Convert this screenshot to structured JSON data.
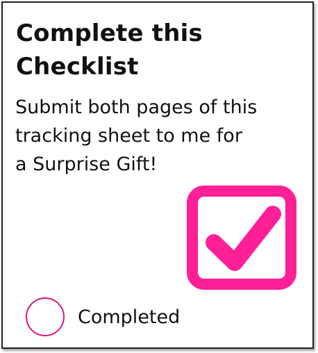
{
  "card": {
    "title_line1": "Complete this",
    "title_line2": "Checklist",
    "body_line1": "Submit both pages of this",
    "body_line2": "tracking sheet to me for",
    "body_line3": "a Surprise Gift!",
    "completed_label": "Completed",
    "completed_checked": false
  },
  "icons": {
    "checkbox": "checkbox-checked-icon",
    "radio": "radio-circle"
  },
  "colors": {
    "accent": "#ff1f96",
    "radio_border": "#d6177e",
    "text": "#111111",
    "border": "#222222"
  }
}
